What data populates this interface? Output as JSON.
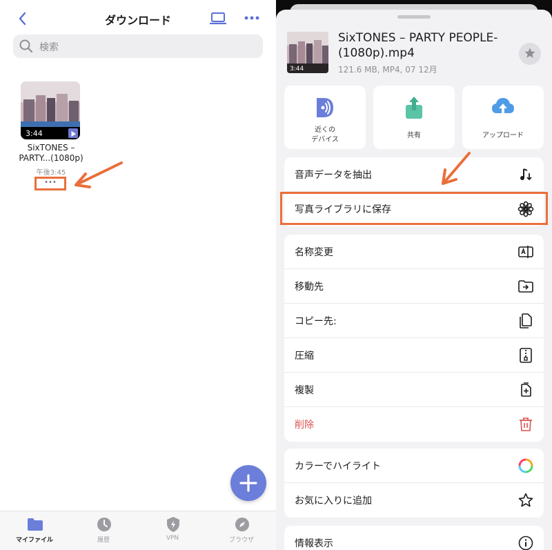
{
  "left": {
    "title": "ダウンロード",
    "search_placeholder": "検索",
    "file": {
      "name_line1": "SixTONES –",
      "name_line2": "PARTY...(1080p)",
      "modified": "午後3:45",
      "duration": "3:44",
      "more": "•••"
    },
    "tabs": [
      {
        "label": "マイファイル",
        "icon": "folder-icon",
        "active": true
      },
      {
        "label": "履歴",
        "icon": "clock-icon",
        "active": false
      },
      {
        "label": "VPN",
        "icon": "shield-icon",
        "active": false
      },
      {
        "label": "ブラウザ",
        "icon": "compass-icon",
        "active": false
      }
    ]
  },
  "right": {
    "file": {
      "title": "SixTONES – PARTY PEOPLE-(1080p).mp4",
      "meta": "121.6 MB, MP4, 07 12月",
      "duration": "3:44"
    },
    "actions": [
      {
        "label_line1": "近くの",
        "label_line2": "デバイス",
        "icon": "airdrop-icon"
      },
      {
        "label_line1": "共有",
        "label_line2": "",
        "icon": "share-icon"
      },
      {
        "label_line1": "アップロード",
        "label_line2": "",
        "icon": "cloud-upload-icon"
      }
    ],
    "group1": [
      {
        "label": "音声データを抽出",
        "icon": "music-note-icon"
      },
      {
        "label": "写真ライブラリに保存",
        "icon": "photos-flower-icon"
      }
    ],
    "group2": [
      {
        "label": "名称変更",
        "icon": "rename-icon"
      },
      {
        "label": "移動先",
        "icon": "move-folder-icon"
      },
      {
        "label": "コピー先:",
        "icon": "copy-icon"
      },
      {
        "label": "圧縮",
        "icon": "zip-icon"
      },
      {
        "label": "複製",
        "icon": "duplicate-icon"
      },
      {
        "label": "削除",
        "icon": "trash-icon",
        "danger": true
      }
    ],
    "group3": [
      {
        "label": "カラーでハイライト",
        "icon": "color-ring-icon"
      },
      {
        "label": "お気に入りに追加",
        "icon": "star-outline-icon"
      }
    ],
    "group4": [
      {
        "label": "情報表示",
        "icon": "info-icon"
      }
    ]
  },
  "colors": {
    "accent": "#6b7ed9",
    "annotation": "#e96f3a",
    "danger": "#d9534f"
  }
}
